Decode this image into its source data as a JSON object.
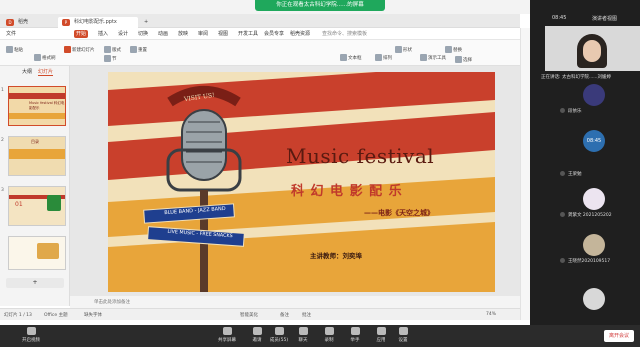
{
  "meeting": {
    "share_banner": "你正在观看太古科幻学院......的屏幕",
    "time": "08:45",
    "layout_label": "演讲者视图",
    "speaking_label": "正在讲话: 太古科幻学院......刘媛婷",
    "participants": [
      {
        "name": "太古科幻学院......刘媛婷"
      },
      {
        "name": "段依乐"
      },
      {
        "name": "08:45"
      },
      {
        "name": "王梁勉"
      },
      {
        "name": "龚紫文 2021205202"
      },
      {
        "name": "王晓然2020109517"
      },
      {
        "name": ""
      }
    ],
    "controls": [
      {
        "label": "开启视频"
      },
      {
        "label": "共享屏幕"
      },
      {
        "label": "邀请"
      },
      {
        "label": "成员(55)"
      },
      {
        "label": "聊天"
      },
      {
        "label": "录制"
      },
      {
        "label": "举手"
      },
      {
        "label": "应用"
      },
      {
        "label": "设置"
      }
    ],
    "leave_label": "离开会议"
  },
  "wps": {
    "tabs": [
      {
        "label": "稻壳",
        "color": "#d14b2a"
      },
      {
        "label": "科幻电影配乐.pptx",
        "color": "#d14b2a"
      }
    ],
    "menus": [
      "文件",
      "开始",
      "插入",
      "设计",
      "切换",
      "动画",
      "放映",
      "审阅",
      "视图",
      "开发工具",
      "会员专享",
      "稻壳资源",
      "查找命令、搜索模板"
    ],
    "ribbon": [
      "粘贴",
      "格式刷",
      "新建幻灯片",
      "版式",
      "节",
      "重置",
      "文本框",
      "排列",
      "形状",
      "替换",
      "演示工具",
      "选择"
    ],
    "panel_tabs": [
      "大纲",
      "幻灯片"
    ],
    "slide_count": [
      "1",
      "2",
      "3"
    ],
    "notes_placeholder": "单击此处添加备注",
    "status": {
      "slide": "幻灯片 1 / 13",
      "theme": "Office 主题",
      "missing_font": "缺失字体",
      "smart": "智能美化",
      "notes": "备注",
      "comment": "批注",
      "zoom": "74%"
    }
  },
  "slide": {
    "badge": "VISIT US!",
    "title": "Music festival",
    "subtitle": "科 幻 电 影 配 乐",
    "movie": "——电影《天空之城》",
    "teacher": "主讲教师：刘奕埠",
    "sign1": "BLUE BAND - JAZZ BAND",
    "sign2": "LIVE MUSIC - FREE SNACKS"
  },
  "thumb_texts": {
    "t1": "Music festival 科幻电影配乐",
    "t2": "目录",
    "t3": "01"
  },
  "colors": {
    "accent": "#d14b2a",
    "slide_cream": "#f2e1ba",
    "slide_red": "#c0392b",
    "slide_orange": "#e8a53a",
    "sign_blue": "#1f3f8f",
    "meeting_bg": "#1f1f1f"
  }
}
